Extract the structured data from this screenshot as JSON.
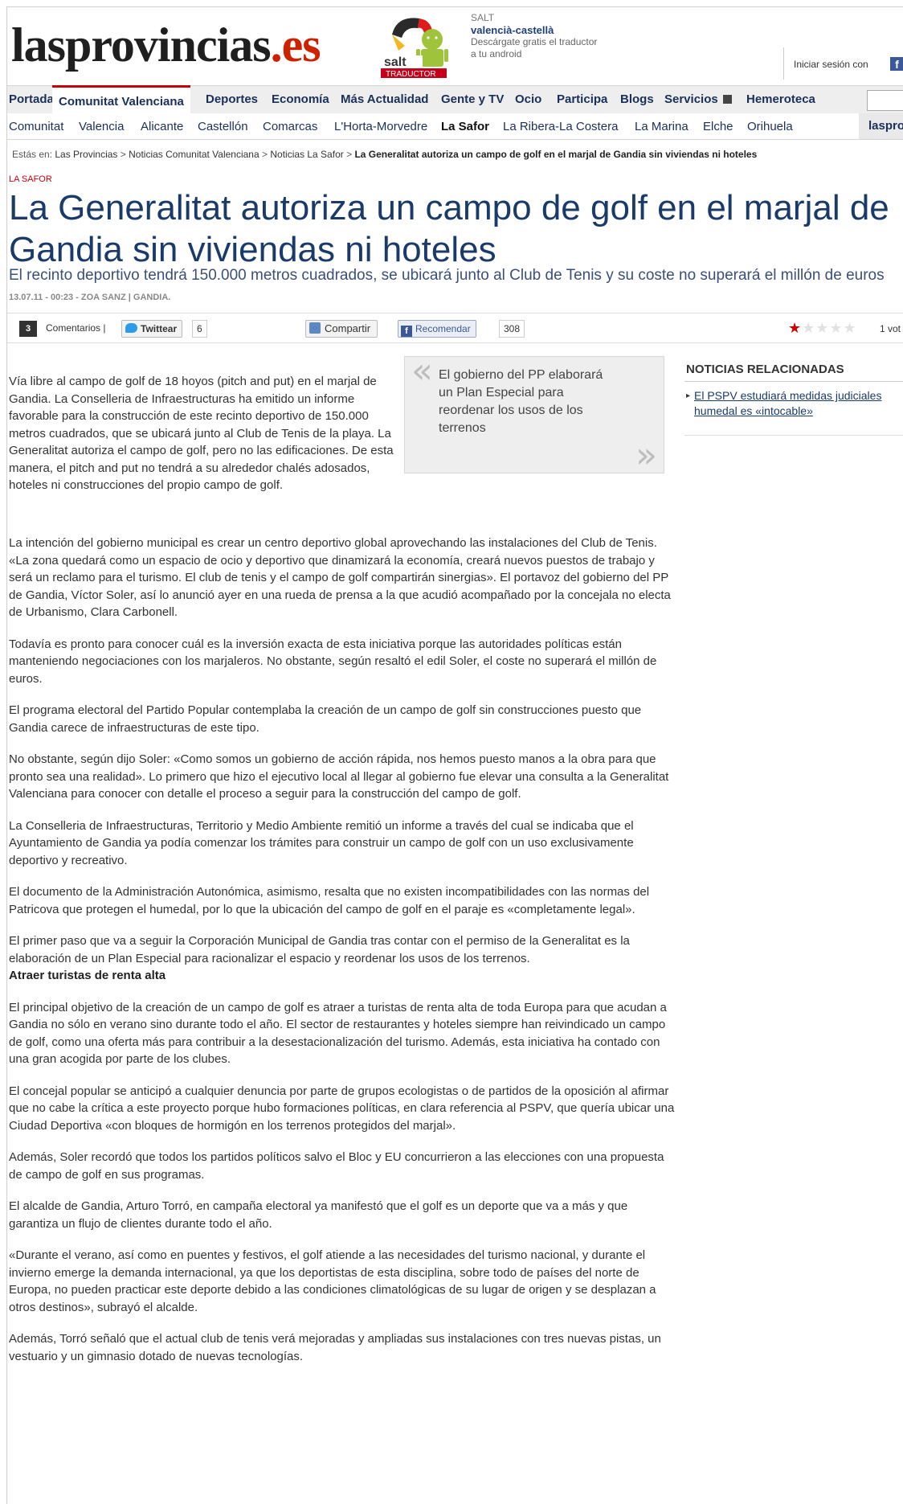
{
  "header": {
    "logo_main": "lasprovincias",
    "logo_suffix": ".es",
    "promo": {
      "badge": "salt",
      "badge_sub": "TRADUCTOR",
      "brand": "SALT",
      "title": "valencià-castellà",
      "line1": "Descárgate gratis el traductor",
      "line2": "a tu android"
    },
    "login_text": "Iniciar sesión con"
  },
  "nav": {
    "items": [
      "Portada",
      "Comunitat Valenciana",
      "Deportes",
      "Economía",
      "Más Actualidad",
      "Gente y TV",
      "Ocio",
      "Participa",
      "Blogs",
      "Servicios",
      "Hemeroteca"
    ]
  },
  "subnav": {
    "items": [
      "Comunitat",
      "Valencia",
      "Alicante",
      "Castellón",
      "Comarcas",
      "L'Horta-Morvedre",
      "La Safor",
      "La Ribera-La Costera",
      "La Marina",
      "Elche",
      "Orihuela"
    ],
    "right_tab": "laspro"
  },
  "breadcrumb": {
    "prefix": "Estás en:",
    "items": [
      "Las Provincias",
      "Noticias Comunitat Valenciana",
      "Noticias La Safor"
    ],
    "current": "La Generalitat autoriza un campo de golf en el marjal de Gandia sin viviendas ni hoteles",
    "sep": ">"
  },
  "article": {
    "section": "LA SAFOR",
    "headline": "La Generalitat autoriza un campo de golf en el marjal de Gandia sin viviendas ni hoteles",
    "subhead": "El recinto deportivo tendrá 150.000 metros cuadrados, se ubicará junto al Club de Tenis y su coste no superará el millón de euros",
    "byline": "13.07.11 - 00:23 - ZOA SANZ | GANDIA.",
    "share": {
      "comments_count": "3",
      "comments_label": "Comentarios |",
      "twitter_label": "Twittear",
      "twitter_count": "6",
      "share_label": "Compartir",
      "fb_label": "Recomendar",
      "fb_count": "308",
      "rating": 1,
      "votes_label": "1 vot"
    },
    "lead": "Vía libre al campo de golf de 18 hoyos (pitch and put) en el marjal de Gandia. La Conselleria de Infraestructuras ha emitido un informe favorable para la construcción de este recinto deportivo de 150.000 metros cuadrados, que se ubicará junto al Club de Tenis de la playa. La Generalitat autoriza el campo de golf, pero no las edificaciones. De esta manera, el pitch and put no tendrá a su alrededor chalés adosados, hoteles ni construcciones del propio campo de golf.",
    "pull_quote": "El gobierno del PP elaborará un Plan Especial para reordenar los usos de los terrenos",
    "paragraphs": [
      "La intención del gobierno municipal es crear un centro deportivo global aprovechando las instalaciones del Club de Tenis.",
      "«La zona quedará como un espacio de ocio y deportivo que dinamizará la economía, creará nuevos puestos de trabajo y será un reclamo para el turismo. El club de tenis y el campo de golf compartirán sinergias». El portavoz del gobierno del PP de Gandia, Víctor Soler, así lo anunció ayer en una rueda de prensa a la que acudió acompañado por la concejala no electa de Urbanismo, Clara Carbonell.",
      "Todavía es pronto para conocer cuál es la inversión exacta de esta iniciativa porque las autoridades políticas están manteniendo negociaciones con los marjaleros. No obstante, según resaltó el edil Soler, el coste no superará el millón de euros.",
      "El programa electoral del Partido Popular contemplaba la creación de un campo de golf sin construcciones puesto que Gandia carece de infraestructuras de este tipo.",
      "No obstante, según dijo Soler: «Como somos un gobierno de acción rápida, nos hemos puesto manos a la obra para que pronto sea una realidad». Lo primero que hizo el ejecutivo local al llegar al gobierno fue elevar una consulta a la Generalitat Valenciana para conocer con detalle el proceso a seguir para la construcción del campo de golf.",
      "La Conselleria de Infraestructuras, Territorio y Medio Ambiente remitió un informe a través del cual se indicaba que el Ayuntamiento de Gandia ya podía comenzar los trámites para construir un campo de golf con un uso exclusivamente deportivo y recreativo.",
      "El documento de la Administración Autonómica, asimismo, resalta que no existen incompatibilidades con las normas del Patricova que protegen el humedal, por lo que la ubicación del campo de golf en el paraje es «completamente legal».",
      "El primer paso que va a seguir la Corporación Municipal de Gandia tras contar con el permiso de la Generalitat es la elaboración de un Plan Especial para racionalizar el espacio y reordenar los usos de los terrenos."
    ],
    "subheading": "Atraer turistas de renta alta",
    "paragraphs2": [
      "El principal objetivo de la creación de un campo de golf es atraer a turistas de renta alta de toda Europa para que acudan a Gandia no sólo en verano sino durante todo el año. El sector de restaurantes y hoteles siempre han reivindicado un campo de golf, como una oferta más para contribuir a la desestacionalización del turismo. Además, esta iniciativa ha contado con una gran acogida por parte de los clubes.",
      "El concejal popular se anticipó a cualquier denuncia por parte de grupos ecologistas o de partidos de la oposición al afirmar que no cabe la crítica a este proyecto porque hubo formaciones políticas, en clara referencia al PSPV, que quería ubicar una Ciudad Deportiva «con bloques de hormigón en los terrenos protegidos del marjal».",
      "Además, Soler recordó que todos los partidos políticos salvo el Bloc y EU concurrieron a las elecciones con una propuesta de campo de golf en sus programas.",
      "El alcalde de Gandia, Arturo Torró, en campaña electoral ya manifestó que el golf es un deporte que va a más y que garantiza un flujo de clientes durante todo el año.",
      "«Durante el verano, así como en puentes y festivos, el golf atiende a las necesidades del turismo nacional, y durante el invierno emerge la demanda internacional, ya que los deportistas de esta disciplina, sobre todo de países del norte de Europa, no pueden practicar este deporte debido a las condiciones climatológicas de su lugar de origen y se desplazan a otros destinos», subrayó el alcalde.",
      "Además, Torró señaló que el actual club de tenis verá mejoradas y ampliadas sus instalaciones con tres nuevas pistas, un vestuario y un gimnasio dotado de nuevas tecnologías."
    ]
  },
  "sidebar": {
    "related_title": "NOTICIAS RELACIONADAS",
    "related_line1": "El PSPV estudiará medidas judiciales",
    "related_line2": "humedal es «intocable»"
  },
  "colors": {
    "brand_red": "#cc2200",
    "headline_blue": "#1a3a6a",
    "nav_active": "#c8000a"
  }
}
